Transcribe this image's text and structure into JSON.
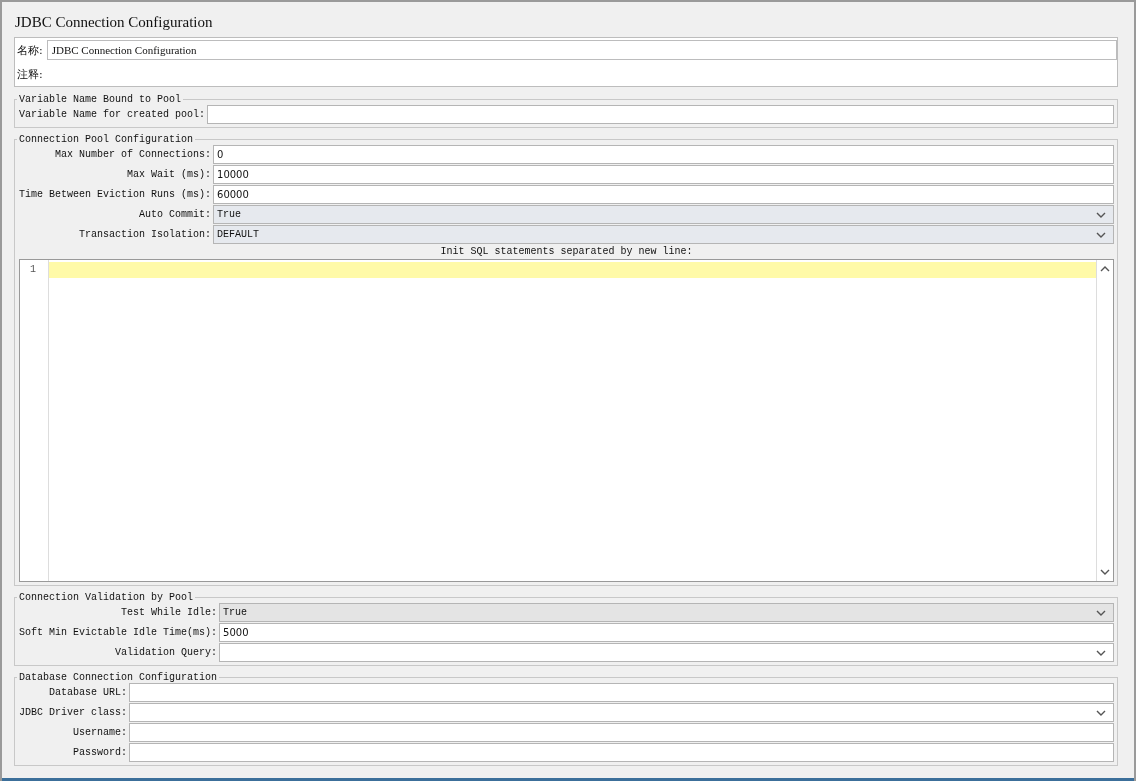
{
  "title": "JDBC Connection Configuration",
  "name_field": {
    "label": "名称:",
    "value": "JDBC Connection Configuration"
  },
  "comment_field": {
    "label": "注释:"
  },
  "groups": [
    {
      "title": "Variable Name Bound to Pool",
      "fields": [
        {
          "label": "Variable Name for created pool:",
          "kind": "text"
        }
      ]
    },
    {
      "title": "Connection Pool Configuration",
      "fields": [
        {
          "label": "Max Number of Connections:",
          "kind": "text",
          "value": "0"
        },
        {
          "label": "Max Wait (ms):",
          "kind": "text",
          "value": "10000"
        },
        {
          "label": "Time Between Eviction Runs (ms):",
          "kind": "text",
          "value": "60000"
        },
        {
          "label": "Auto Commit:",
          "kind": "select",
          "value": "True"
        },
        {
          "label": "Transaction Isolation:",
          "kind": "select",
          "value": "DEFAULT"
        }
      ],
      "editor": {
        "label": "Init SQL statements separated by new line:",
        "lines": [
          "1"
        ]
      }
    },
    {
      "title": "Connection Validation by Pool",
      "fields": [
        {
          "label": "Test While Idle:",
          "kind": "select",
          "value": "True"
        },
        {
          "label": "Soft Min Evictable Idle Time(ms):",
          "kind": "text",
          "value": "5000"
        },
        {
          "label": "Validation Query:",
          "kind": "combo"
        }
      ]
    },
    {
      "title": "Database Connection Configuration",
      "fields": [
        {
          "label": "Database URL:",
          "kind": "text"
        },
        {
          "label": "JDBC Driver class:",
          "kind": "combo"
        },
        {
          "label": "Username:",
          "kind": "text"
        },
        {
          "label": "Password:",
          "kind": "text"
        }
      ]
    }
  ]
}
